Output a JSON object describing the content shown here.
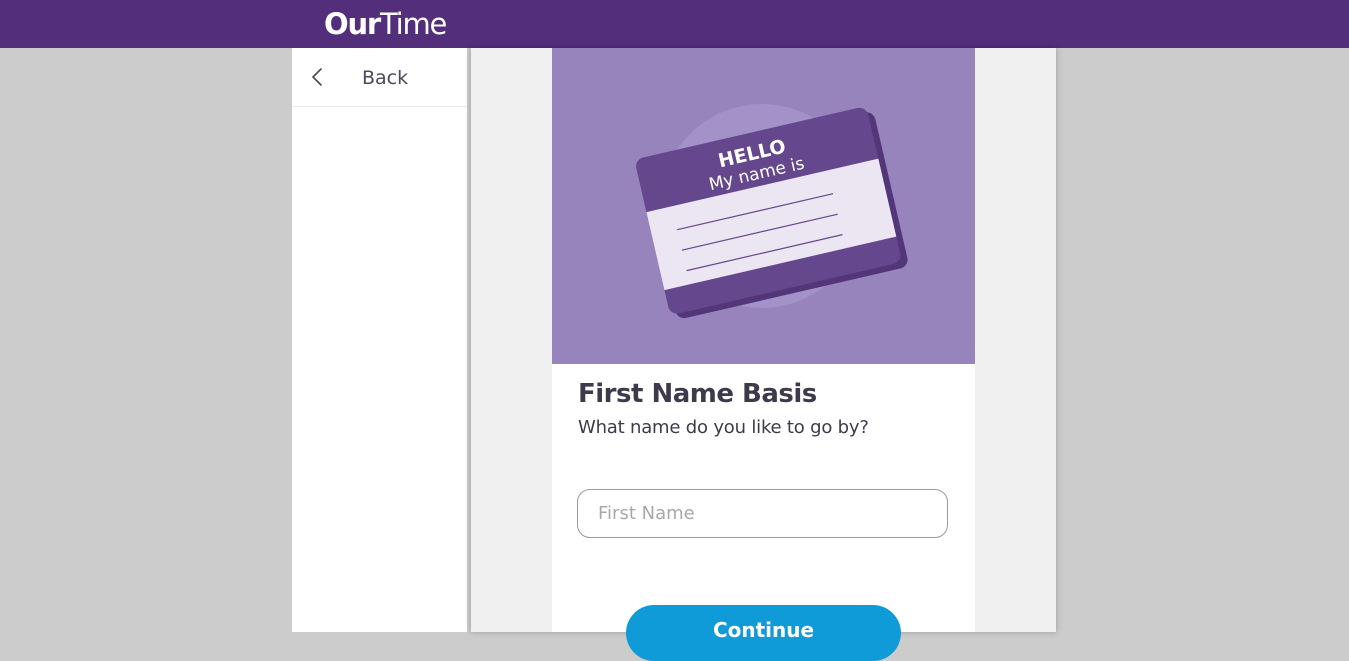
{
  "header": {
    "brand_bold": "Our",
    "brand_light": "Time"
  },
  "sidebar": {
    "back_label": "Back"
  },
  "hero": {
    "badge_line1": "HELLO",
    "badge_line2": "My name is"
  },
  "form": {
    "title": "First Name Basis",
    "subtitle": "What name do you like to go by?",
    "first_name_value": "",
    "first_name_placeholder": "First Name",
    "continue_label": "Continue"
  },
  "colors": {
    "brand_purple": "#532e7b",
    "hero_background": "#9784bd",
    "badge_purple": "#65478e",
    "continue_blue": "#0e9bd8",
    "page_background": "#cccccc"
  }
}
